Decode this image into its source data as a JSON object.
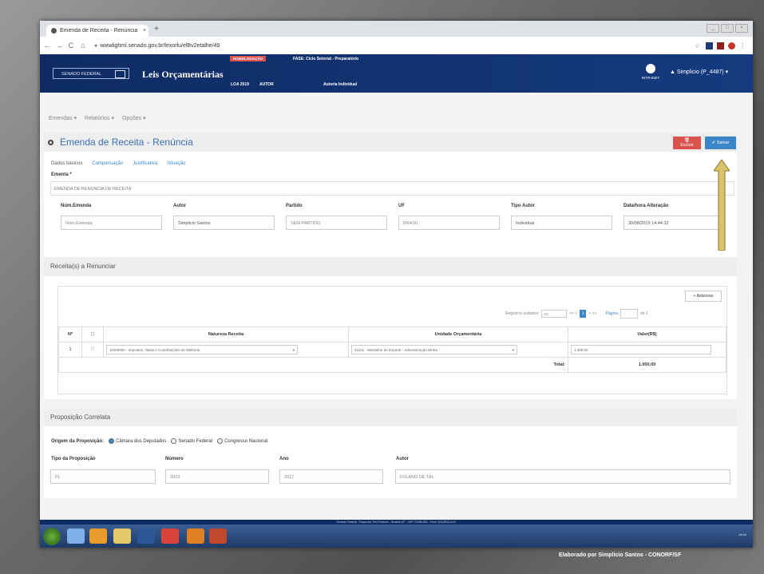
{
  "browser": {
    "tab_title": "Emenda de Receita - Renúncia",
    "tab_close": "×",
    "new_tab": "+",
    "url": "wwwlighml.senado.gov.br/lexorlu/elBv2etalhe/49",
    "nav_back": "←",
    "nav_forward": "→",
    "nav_reload": "C",
    "nav_home": "⌂",
    "lock": "🔒"
  },
  "header": {
    "logo": "SENADO FEDERAL",
    "app_title": "Leis Orçamentárias",
    "env_badge": "HOMOLOGAÇÃO",
    "phase": "FASE: Ciclo Setorial - Preparatório",
    "loa": "LOA 2019",
    "autor_label": "AUTOR",
    "autor_value": "Autoria Individual",
    "intranet": "INTRANET",
    "user": "▲ Simplicio (P_4487) ▾"
  },
  "menu": {
    "items": [
      "Emendas ▾",
      "Relatórios ▾",
      "Opções ▾"
    ]
  },
  "panel": {
    "title": "Emenda de Receita - Renúncia",
    "excluir": "🗑 Excluir",
    "salvar": "✔ Salvar",
    "tabs": [
      "Dados básicos",
      "Compensação",
      "Justificativa",
      "Situação"
    ],
    "ementa_label": "Ementa *",
    "ementa_value": "EMENDA DE RENUNCIA DE RECEITA",
    "fields": [
      {
        "label": "Núm.Emenda",
        "value": "Núm.Emenda"
      },
      {
        "label": "Autor",
        "value": "Simplicio Santos"
      },
      {
        "label": "Partido",
        "value": "SEM PARTIDO"
      },
      {
        "label": "UF",
        "value": "BRASIL"
      },
      {
        "label": "Tipo Autor",
        "value": "Individual"
      },
      {
        "label": "Data/hora Alteração",
        "value": "30/08/2019 14:44:32"
      }
    ]
  },
  "receitas": {
    "title": "Receita(s) a Renunciar",
    "add": "+ Adicionar",
    "pager": {
      "label": "Registros exibidos:",
      "per_page": "20",
      "page": "1",
      "page_label": "Página",
      "of": "de 1",
      "prev": "<<  <",
      "next": ">  >>"
    },
    "columns": [
      "Nº",
      "☐",
      "Natureza Receita",
      "Unidade Orçamentária",
      "Valor(R$)"
    ],
    "rows": [
      {
        "n": "1",
        "check": "☐",
        "natureza": "11000000 - Impostos, Taxas e Contribuições de Melhoria",
        "unidade": "51101 - Ministério do Esporte - Administração Direta",
        "valor": "1.000,00"
      }
    ],
    "total_label": "Total:",
    "total_value": "1.000,00"
  },
  "proposicao": {
    "title": "Proposição Correlata",
    "origem_label": "Origem da Proposição:",
    "origem_options": [
      "Câmara dos Deputados",
      "Senado Federal",
      "Congresso Nacional"
    ],
    "fields": [
      {
        "label": "Tipo da Proposição",
        "value": "PL"
      },
      {
        "label": "Número",
        "value": "2023"
      },
      {
        "label": "Ano",
        "value": "2017"
      },
      {
        "label": "Autor",
        "value": "FULANO DE TAL"
      }
    ]
  },
  "status_bar": "Senado Federal - Praça dos Três Poderes - Brasília DF - CEP 70165-900 - Fone: (61)3303-4141",
  "taskbar_time": "14:44",
  "caption": "Elaborado por Simplício Santos - CONORF/SF",
  "colors": {
    "header": "#0e2b63",
    "accent": "#3a87c8",
    "danger": "#d9534f",
    "arrow": "#c9b24a"
  }
}
